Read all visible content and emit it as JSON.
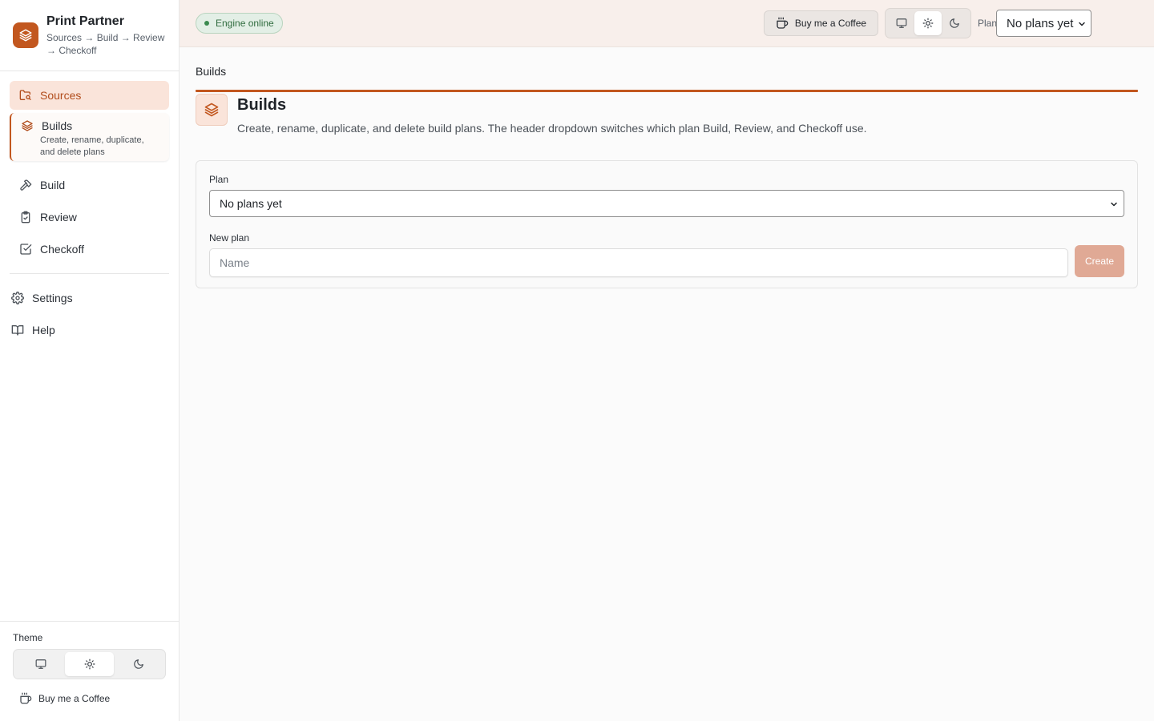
{
  "app": {
    "title": "Print Partner",
    "subtitle": "Sources → Build → Review → Checkoff"
  },
  "sidebar": {
    "items": [
      {
        "label": "Sources",
        "icon": "folder-search-icon",
        "state": "active"
      },
      {
        "label": "Builds",
        "icon": "layers-icon",
        "state": "current",
        "description": "Create, rename, duplicate, and delete plans"
      },
      {
        "label": "Build",
        "icon": "hammer-icon"
      },
      {
        "label": "Review",
        "icon": "clipboard-check-icon"
      },
      {
        "label": "Checkoff",
        "icon": "square-check-icon"
      }
    ],
    "secondary": [
      {
        "label": "Settings",
        "icon": "gear-icon"
      },
      {
        "label": "Help",
        "icon": "book-icon"
      }
    ],
    "theme_label": "Theme",
    "theme_options": [
      "system",
      "light",
      "dark"
    ],
    "theme_selected": "light",
    "coffee_label": "Buy me a Coffee"
  },
  "header": {
    "status": "Engine online",
    "coffee_label": "Buy me a Coffee",
    "theme_selected": "light",
    "plan_label": "Plan",
    "plan_value": "No plans yet"
  },
  "main": {
    "breadcrumb": "Builds",
    "title": "Builds",
    "description": "Create, rename, duplicate, and delete build plans. The header dropdown switches which plan Build, Review, and Checkoff use.",
    "form": {
      "plan_label": "Plan",
      "plan_value": "No plans yet",
      "new_plan_label": "New plan",
      "new_plan_placeholder": "Name",
      "create_label": "Create"
    }
  },
  "colors": {
    "accent": "#c2571f",
    "accent_soft": "#fae4da",
    "status_green": "#3b8a4f"
  }
}
